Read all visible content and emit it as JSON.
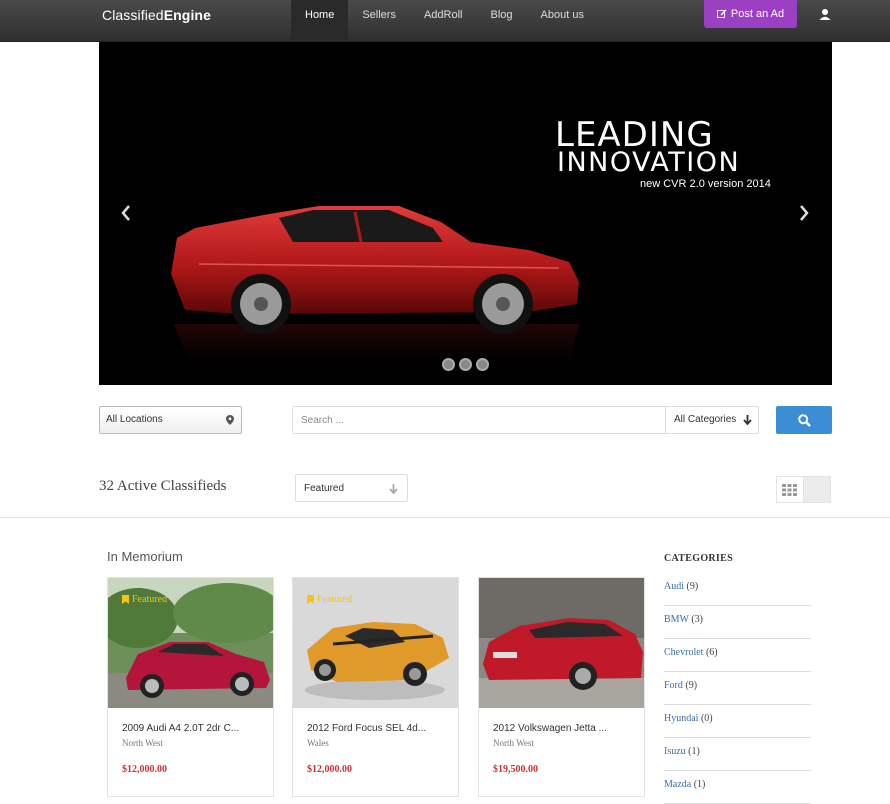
{
  "header": {
    "brand_part1": "Classified",
    "brand_part2": "Engine",
    "nav": [
      "Home",
      "Sellers",
      "AddRoll",
      "Blog",
      "About us"
    ],
    "post_ad_label": "Post an Ad",
    "icons": {
      "post": "edit-icon",
      "user": "user-icon"
    }
  },
  "hero": {
    "headline1": "LEADING",
    "headline2": "INNOVATION",
    "tagline": "new CVR 2.0 version 2014",
    "slides": 3,
    "active_slide": 3
  },
  "search": {
    "location_label": "All Locations",
    "placeholder": "Search ...",
    "category_label": "All Categories"
  },
  "results": {
    "count_text": "32 Active Classifieds",
    "sort_label": "Featured"
  },
  "listings": {
    "section_title": "In Memorium",
    "items": [
      {
        "badge": "Featured",
        "title": "2009 Audi A4 2.0T 2dr C...",
        "location": "North West",
        "price": "$12,000.00"
      },
      {
        "badge": "Featured",
        "title": "2012 Ford Focus SEL 4d...",
        "location": "Wales",
        "price": "$12,000.00"
      },
      {
        "badge": "",
        "title": "2012 Volkswagen Jetta ...",
        "location": "North West",
        "price": "$19,500.00"
      }
    ]
  },
  "categories": {
    "heading": "CATEGORIES",
    "items": [
      {
        "name": "Audi",
        "count": "(9)"
      },
      {
        "name": "BMW",
        "count": "(3)"
      },
      {
        "name": "Chevrolet",
        "count": "(6)"
      },
      {
        "name": "Ford",
        "count": "(9)"
      },
      {
        "name": "Hyundai",
        "count": "(0)"
      },
      {
        "name": "Isuzu",
        "count": "(1)"
      },
      {
        "name": "Mazda",
        "count": "(1)"
      }
    ]
  },
  "colors": {
    "topbar": "#3a3a3a",
    "post_ad": "#9b3fc3",
    "search_button": "#3b8ed4",
    "price": "#cc3333",
    "featured_badge": "#f5c518",
    "category_link": "#3a6ea5"
  }
}
